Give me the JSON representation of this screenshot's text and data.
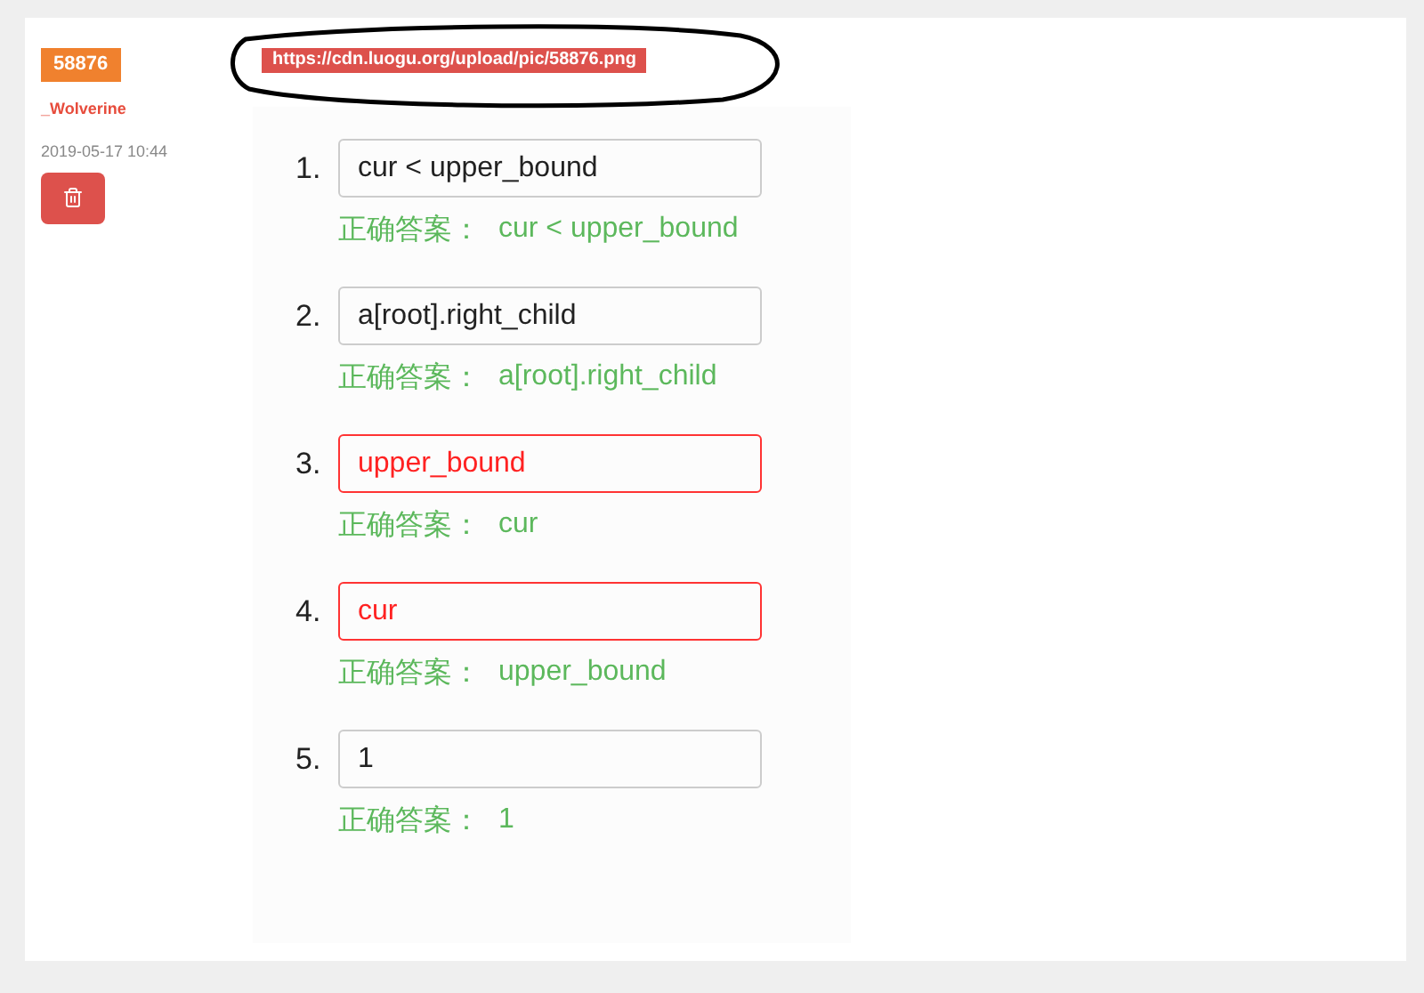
{
  "post": {
    "id_badge": "58876",
    "author": "_Wolverine",
    "time": "2019-05-17 10:44",
    "url_tag": "https://cdn.luogu.org/upload/pic/58876.png"
  },
  "answers": [
    {
      "number": "1.",
      "value": "cur < upper_bound",
      "correct": true,
      "answer_label": "正确答案：",
      "answer": "cur < upper_bound"
    },
    {
      "number": "2.",
      "value": "a[root].right_child",
      "correct": true,
      "answer_label": "正确答案：",
      "answer": "a[root].right_child"
    },
    {
      "number": "3.",
      "value": "upper_bound",
      "correct": false,
      "answer_label": "正确答案：",
      "answer": "cur"
    },
    {
      "number": "4.",
      "value": "cur",
      "correct": false,
      "answer_label": "正确答案：",
      "answer": "upper_bound"
    },
    {
      "number": "5.",
      "value": "1",
      "correct": true,
      "answer_label": "正确答案：",
      "answer": "1"
    }
  ]
}
